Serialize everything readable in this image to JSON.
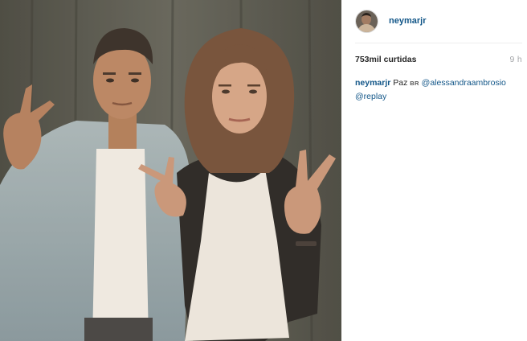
{
  "post": {
    "username": "neymarjr",
    "likes": "753mil curtidas",
    "time_ago": "9 h",
    "caption": {
      "author": "neymarjr",
      "text": "Paz",
      "flag": "BR",
      "mentions": [
        "@alessandraambrosio",
        "@replay"
      ]
    },
    "colors": {
      "link": "#125688",
      "muted": "#a5a7aa",
      "divider": "#efefef"
    }
  },
  "icons": {
    "avatar": "profile-avatar-icon"
  }
}
